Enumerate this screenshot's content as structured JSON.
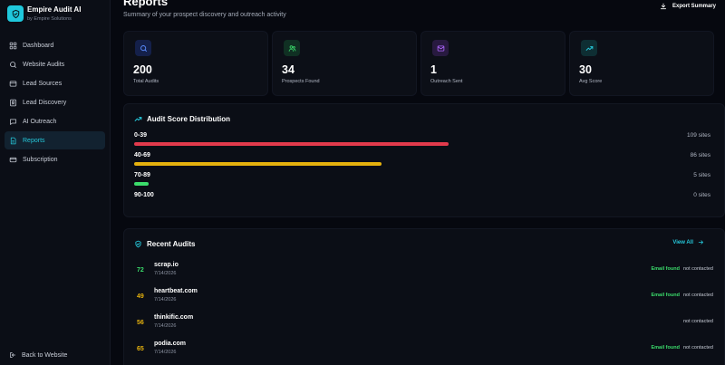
{
  "app": {
    "title": "Empire Audit AI",
    "subtitle": "by Empire Solutions",
    "accent": "#1fc8dc"
  },
  "sidebar": {
    "items": [
      {
        "label": "Dashboard",
        "icon": "dashboard-icon",
        "active": false
      },
      {
        "label": "Website Audits",
        "icon": "search-icon",
        "active": false
      },
      {
        "label": "Lead Sources",
        "icon": "lead-sources-icon",
        "active": false
      },
      {
        "label": "Lead Discovery",
        "icon": "lead-discovery-icon",
        "active": false
      },
      {
        "label": "AI Outreach",
        "icon": "chat-icon",
        "active": false
      },
      {
        "label": "Reports",
        "icon": "reports-icon",
        "active": true
      },
      {
        "label": "Subscription",
        "icon": "card-icon",
        "active": false
      }
    ],
    "back_label": "Back to Website"
  },
  "header": {
    "title": "Reports",
    "subtitle": "Summary of your prospect discovery and outreach activity",
    "export_label": "Export Summary"
  },
  "stats": [
    {
      "value": "200",
      "label": "Total Audits",
      "icon": "search-icon",
      "color": "#5b8cff"
    },
    {
      "value": "34",
      "label": "Prospects Found",
      "icon": "users-icon",
      "color": "#3bdc6b"
    },
    {
      "value": "1",
      "label": "Outreach Sent",
      "icon": "mail-icon",
      "color": "#b066ff"
    },
    {
      "value": "30",
      "label": "Avg Score",
      "icon": "trending-icon",
      "color": "#26c9dc"
    }
  ],
  "distribution": {
    "title": "Audit Score Distribution",
    "max_sites": 200,
    "rows": [
      {
        "label": "0-39",
        "count_label": "109 sites",
        "count": 109,
        "color": "#e33a4c"
      },
      {
        "label": "40-69",
        "count_label": "86 sites",
        "count": 86,
        "color": "#e5b10e"
      },
      {
        "label": "70-89",
        "count_label": "5 sites",
        "count": 5,
        "color": "#3bdc6b"
      },
      {
        "label": "90-100",
        "count_label": "0 sites",
        "count": 0,
        "color": "#3bdc6b"
      }
    ]
  },
  "recent": {
    "title": "Recent Audits",
    "view_all": "View All",
    "rows": [
      {
        "score": "72",
        "score_color": "#3bdc6b",
        "domain": "scrap.io",
        "date": "7/14/2026",
        "email_found": "Email found",
        "status": "not contacted"
      },
      {
        "score": "49",
        "score_color": "#e5b10e",
        "domain": "heartbeat.com",
        "date": "7/14/2026",
        "email_found": "Email found",
        "status": "not contacted"
      },
      {
        "score": "56",
        "score_color": "#e5b10e",
        "domain": "thinkific.com",
        "date": "7/14/2026",
        "email_found": "",
        "status": "not contacted"
      },
      {
        "score": "65",
        "score_color": "#e5b10e",
        "domain": "podia.com",
        "date": "7/14/2026",
        "email_found": "Email found",
        "status": "not contacted"
      }
    ]
  }
}
